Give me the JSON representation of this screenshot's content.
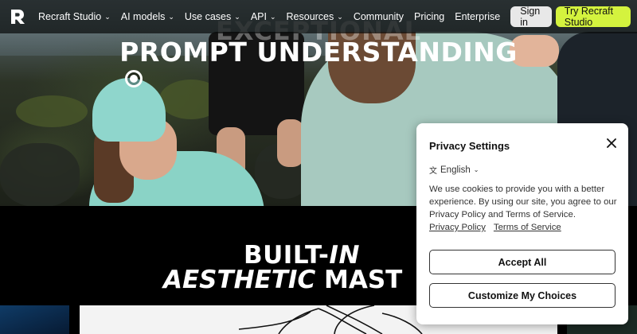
{
  "nav": {
    "logo": "R",
    "items": [
      {
        "label": "Recraft Studio",
        "dropdown": true
      },
      {
        "label": "AI models",
        "dropdown": true
      },
      {
        "label": "Use cases",
        "dropdown": true
      },
      {
        "label": "API",
        "dropdown": true
      },
      {
        "label": "Resources",
        "dropdown": true
      },
      {
        "label": "Community",
        "dropdown": false
      },
      {
        "label": "Pricing",
        "dropdown": false
      },
      {
        "label": "Enterprise",
        "dropdown": false
      }
    ],
    "signin_label": "Sign in",
    "try_label": "Try Recraft Studio"
  },
  "hero": {
    "title_ghost": "EXCEPTIONAL",
    "title": "PROMPT UNDERSTANDING"
  },
  "section2": {
    "line1_a": "BUILT-",
    "line1_b": "IN",
    "line2_a": "AESTHETIC",
    "line2_b": " MAST"
  },
  "privacy": {
    "title": "Privacy Settings",
    "language": "English",
    "body": "We use cookies to provide you with a better experience. By using our site, you agree to our Privacy Policy and Terms of Service.",
    "link_privacy": "Privacy Policy",
    "link_terms": "Terms of Service",
    "accept_label": "Accept All",
    "customize_label": "Customize My Choices"
  },
  "colors": {
    "accent": "#d4f33e",
    "nav_bg": "#0a0c0c",
    "dialog_bg": "#ffffff"
  },
  "icons": {
    "close": "close-icon",
    "chevron": "chevron-down-icon",
    "language": "translate-icon",
    "hotspot": "hotspot-icon"
  }
}
